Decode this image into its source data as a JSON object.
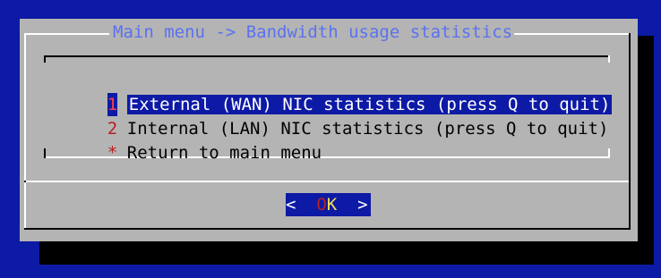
{
  "dialog": {
    "title": "Main menu -> Bandwidth usage statistics",
    "menu": [
      {
        "tag": "1",
        "label": "External (WAN) NIC statistics (press Q to quit)",
        "selected": true
      },
      {
        "tag": "2",
        "label": "Internal (LAN) NIC statistics (press Q to quit)",
        "selected": false
      },
      {
        "tag": "*",
        "label": "Return to main menu",
        "selected": false
      }
    ],
    "ok_button": {
      "left_bracket": "<",
      "hotkey_prefix": "O",
      "hotkey": "K",
      "right_bracket": ">"
    }
  },
  "colors": {
    "background": "#0d1aa5",
    "dialog": "#b4b4b4",
    "title": "#5a72f0",
    "tag": "#b82020",
    "hotkey": "#f2e24a"
  }
}
